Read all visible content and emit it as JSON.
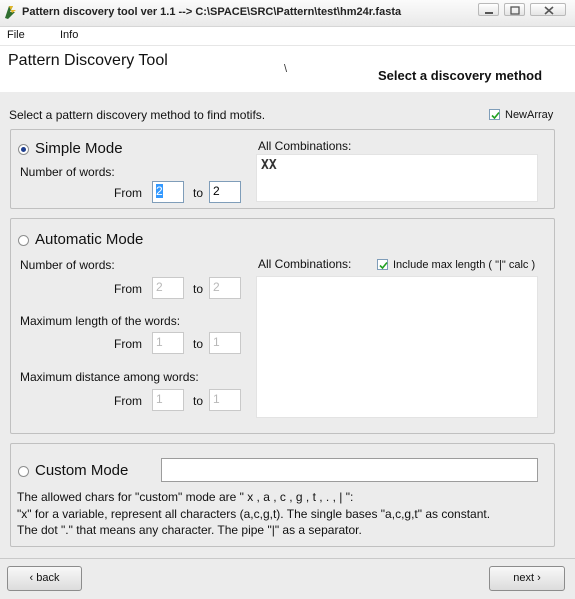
{
  "window": {
    "title": "Pattern discovery tool ver 1.1  --> C:\\SPACE\\SRC\\Pattern\\test\\hm24r.fasta"
  },
  "menu": {
    "file": "File",
    "info": "Info"
  },
  "header": {
    "title": "Pattern Discovery Tool",
    "subtitle": "Select a discovery method",
    "cursor_glyph": "\\"
  },
  "instruction": "Select a pattern discovery method to find motifs.",
  "new_array": {
    "label": "NewArray",
    "checked": true
  },
  "simple": {
    "title": "Simple Mode",
    "selected": true,
    "words_label": "Number of words:",
    "from_label": "From",
    "to_label": "to",
    "from_value": "2",
    "to_value": "2",
    "combinations_label": "All Combinations:",
    "combinations_value": "XX"
  },
  "automatic": {
    "title": "Automatic Mode",
    "selected": false,
    "words_label": "Number of words:",
    "from_label": "From",
    "to_label": "to",
    "words_from": "2",
    "words_to": "2",
    "maxlen_label": "Maximum length of the words:",
    "maxlen_from": "1",
    "maxlen_to": "1",
    "maxdist_label": "Maximum distance among words:",
    "maxdist_from": "1",
    "maxdist_to": "1",
    "combinations_label": "All Combinations:",
    "include_max_label": "Include max length ( \"|\" calc )",
    "include_max_checked": true
  },
  "custom": {
    "title": "Custom Mode",
    "selected": false,
    "input_value": "",
    "help_line1": "The allowed chars for \"custom\" mode are \" x , a , c , g , t , . , | \":",
    "help_line2": "\"x\" for a variable, represent all characters (a,c,g,t). The single bases \"a,c,g,t\" as constant.",
    "help_line3": "The dot \".\" that means any character.  The pipe \"|\" as a separator."
  },
  "footer": {
    "back_label": "‹ back",
    "next_label": "next ›"
  }
}
